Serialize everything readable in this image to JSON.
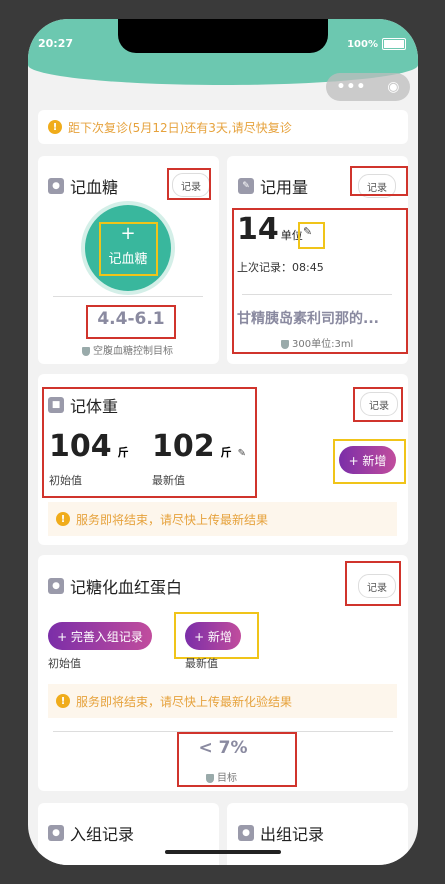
{
  "status": {
    "time": "20:27",
    "battery": "100%"
  },
  "notice": {
    "text": "距下次复诊(5月12日)还有3天,请尽快复诊"
  },
  "glucose": {
    "title": "记血糖",
    "record": "记录",
    "button": "记血糖",
    "plus": "+",
    "range": "4.4-6.1",
    "target_label": "空腹血糖控制目标"
  },
  "dosage": {
    "title": "记用量",
    "record": "记录",
    "amount": "14",
    "unit": "单位",
    "last": "上次记录：08:45",
    "drug": "甘精胰岛素利司那的...",
    "spec": "300单位:3ml"
  },
  "weight": {
    "title": "记体重",
    "record": "记录",
    "initial": "104",
    "initial_unit": "斤",
    "initial_label": "初始值",
    "latest": "102",
    "latest_unit": "斤",
    "latest_label": "最新值",
    "add": "+ 新增",
    "warning": "服务即将结束，请尽快上传最新结果"
  },
  "hba1c": {
    "title": "记糖化血红蛋白",
    "record": "记录",
    "complete": "+ 完善入组记录",
    "initial_label": "初始值",
    "add": "+ 新增",
    "latest_label": "最新值",
    "warning": "服务即将结束，请尽快上传最新化验结果",
    "target": "< 7%",
    "target_label": "目标"
  },
  "enroll": {
    "title": "入组记录"
  },
  "exit": {
    "title": "出组记录"
  },
  "colors": {
    "teal": "#6cc8b0",
    "purple": "#7b2ea8",
    "warn": "#e6a23c"
  }
}
